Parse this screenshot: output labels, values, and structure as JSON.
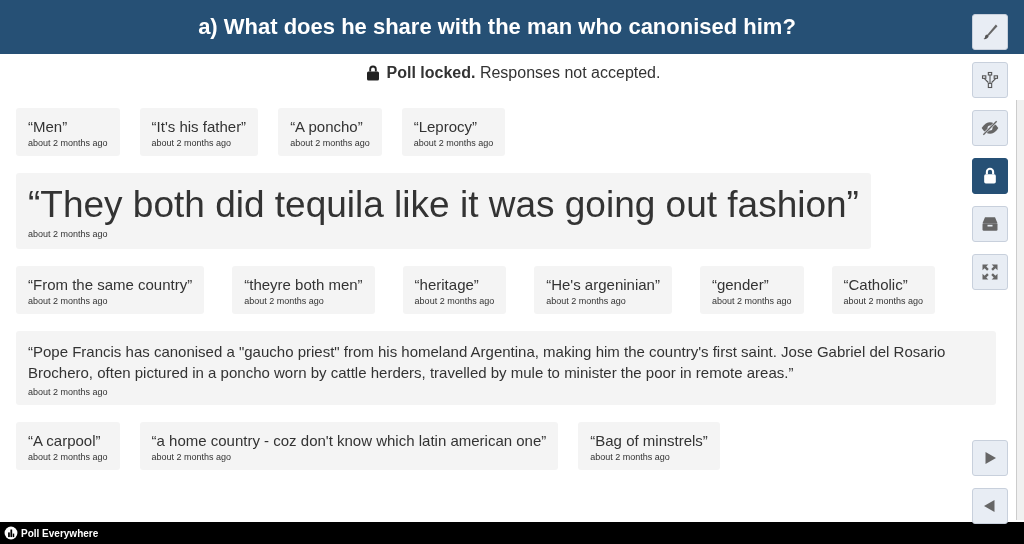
{
  "header": {
    "title": "a) What does he share with the man who canonised him?"
  },
  "status": {
    "locked": true,
    "bold": "Poll locked.",
    "text": "Responses not accepted."
  },
  "response_rows": [
    [
      {
        "kind": "normal",
        "text": "“Men”",
        "time": "about 2 months ago"
      },
      {
        "kind": "normal",
        "text": "“It's his father”",
        "time": "about 2 months ago"
      },
      {
        "kind": "normal",
        "text": "“A poncho”",
        "time": "about 2 months ago"
      },
      {
        "kind": "normal",
        "text": "“Leprocy”",
        "time": "about 2 months ago"
      }
    ],
    [
      {
        "kind": "large",
        "text": "“They both did tequila like it was going out fashion”",
        "time": "about 2 months ago"
      }
    ],
    [
      {
        "kind": "normal",
        "text": "“From the same country”",
        "time": "about 2 months ago"
      },
      {
        "kind": "normal",
        "text": "“theyre both men”",
        "time": "about 2 months ago"
      },
      {
        "kind": "normal",
        "text": "“heritage”",
        "time": "about 2 months ago"
      },
      {
        "kind": "normal",
        "text": "“He's argeninian”",
        "time": "about 2 months ago"
      },
      {
        "kind": "normal",
        "text": "“gender”",
        "time": "about 2 months ago"
      },
      {
        "kind": "normal",
        "text": "“Catholic”",
        "time": "about 2 months ago"
      }
    ],
    [
      {
        "kind": "long",
        "text": "“Pope Francis has canonised a \"gaucho priest\" from his homeland Argentina, making him the country's first saint. Jose Gabriel del Rosario Brochero, often pictured in a poncho worn by cattle herders, travelled by mule to minister the poor in remote areas.”",
        "time": "about 2 months ago"
      }
    ],
    [
      {
        "kind": "normal",
        "text": "“A carpool”",
        "time": "about 2 months ago"
      },
      {
        "kind": "normal",
        "text": "“a home country - coz don't know which latin american one”",
        "time": "about 2 months ago"
      },
      {
        "kind": "normal",
        "text": "“Bag of minstrels”",
        "time": "about 2 months ago"
      }
    ]
  ],
  "tools": [
    {
      "kind": "brush",
      "selected": false
    },
    {
      "kind": "network",
      "selected": false
    },
    {
      "kind": "hide",
      "selected": false
    },
    {
      "kind": "lock",
      "selected": true
    },
    {
      "kind": "archive",
      "selected": false
    },
    {
      "kind": "fullscreen",
      "selected": false
    }
  ],
  "nav": [
    {
      "kind": "next"
    },
    {
      "kind": "previous"
    }
  ],
  "footer": {
    "brand": "Poll Everywhere"
  }
}
